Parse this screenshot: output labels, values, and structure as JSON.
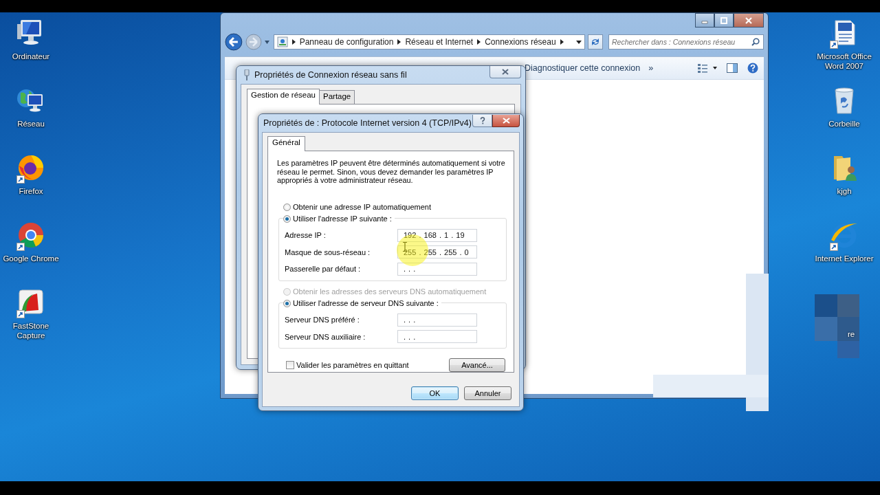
{
  "desktop": {
    "left_icons": [
      {
        "label": "Ordinateur",
        "shortcut": false
      },
      {
        "label": "Réseau",
        "shortcut": false
      },
      {
        "label": "Firefox",
        "shortcut": true
      },
      {
        "label": "Google Chrome",
        "shortcut": true
      },
      {
        "label": "FastStone Capture",
        "shortcut": true
      }
    ],
    "right_icons": [
      {
        "label": "Microsoft Office Word 2007",
        "shortcut": true
      },
      {
        "label": "Corbeille",
        "shortcut": false
      },
      {
        "label": "kjgh",
        "shortcut": false
      },
      {
        "label": "Internet Explorer",
        "shortcut": true
      }
    ],
    "partial_label": "re"
  },
  "explorer": {
    "breadcrumb": [
      "Panneau de configuration",
      "Réseau et Internet",
      "Connexions réseau"
    ],
    "search": {
      "placeholder": "Rechercher dans : Connexions réseau"
    },
    "toolbar": [
      "Diagnostiquer cette connexion",
      "»"
    ]
  },
  "back_dialog": {
    "title": "Propriétés de Connexion réseau sans fil",
    "tabs": [
      {
        "label": "Gestion de réseau",
        "selected": true
      },
      {
        "label": "Partage",
        "selected": false
      }
    ]
  },
  "dialog": {
    "title": "Propriétés de : Protocole Internet version 4 (TCP/IPv4)",
    "tabs": [
      {
        "label": "Général",
        "selected": true
      }
    ],
    "description": "Les paramètres IP peuvent être déterminés automatiquement si votre réseau le permet. Sinon, vous devez demander les paramètres IP appropriés à votre administrateur réseau.",
    "ip_options": [
      {
        "label": "Obtenir une adresse IP automatiquement",
        "selected": false,
        "disabled": false
      },
      {
        "label": "Utiliser l'adresse IP suivante :",
        "selected": true,
        "disabled": false
      }
    ],
    "ip_fields": [
      {
        "label": "Adresse IP :",
        "value": "192 . 168 . 1 . 19"
      },
      {
        "label": "Masque de sous-réseau :",
        "value": "255 . 255 . 255 . 0"
      },
      {
        "label": "Passerelle par défaut :",
        "value": ". . ."
      }
    ],
    "dns_options": [
      {
        "label": "Obtenir les adresses des serveurs DNS automatiquement",
        "selected": false,
        "disabled": true
      },
      {
        "label": "Utiliser l'adresse de serveur DNS suivante :",
        "selected": true,
        "disabled": false
      }
    ],
    "dns_fields": [
      {
        "label": "Serveur DNS préféré :",
        "value": ". . ."
      },
      {
        "label": "Serveur DNS auxiliaire :",
        "value": ". . ."
      }
    ],
    "validate": {
      "label": "Valider les paramètres en quittant",
      "checked": false
    },
    "advanced_button": "Avancé...",
    "buttons": [
      {
        "label": "OK",
        "default": true
      },
      {
        "label": "Annuler",
        "default": false
      }
    ]
  }
}
